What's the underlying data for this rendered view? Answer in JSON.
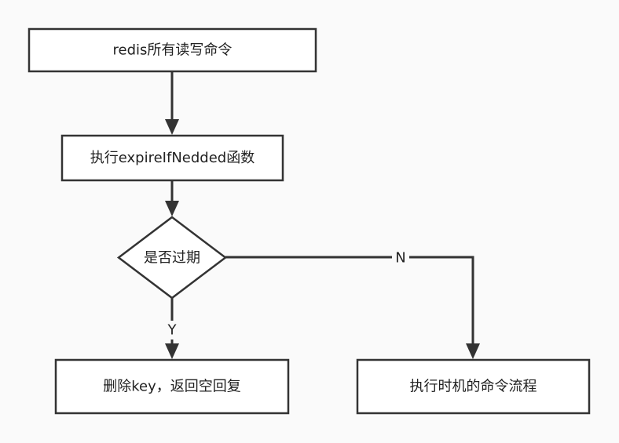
{
  "nodes": {
    "start": "redis所有读写命令",
    "call": "执行expireIfNedded函数",
    "decision": "是否过期",
    "delete": "删除key，返回空回复",
    "continue": "执行时机的命令流程"
  },
  "edges": {
    "yes_label": "Y",
    "no_label": "N"
  },
  "colors": {
    "stroke": "#333333",
    "background": "#fafafa",
    "fill": "#ffffff"
  }
}
